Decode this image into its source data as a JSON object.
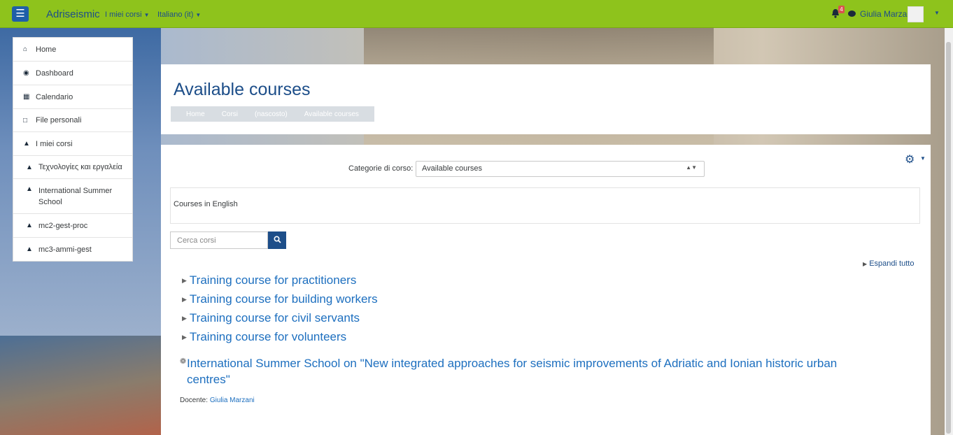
{
  "navbar": {
    "brand": "Adriseismic",
    "menus": [
      {
        "label": "I miei corsi",
        "icon": "caret-down-icon"
      },
      {
        "label": "Italiano (it)",
        "icon": "caret-down-icon"
      }
    ],
    "notification_count": "4",
    "user_name": "Giulia Marzani",
    "colors": {
      "bar": "#8ec31c",
      "toggle": "#1f5fa8"
    }
  },
  "sidebar": {
    "items": [
      {
        "label": "Home",
        "icon": "home-icon"
      },
      {
        "label": "Dashboard",
        "icon": "dashboard-icon"
      },
      {
        "label": "Calendario",
        "icon": "calendar-icon"
      },
      {
        "label": "File personali",
        "icon": "file-icon"
      },
      {
        "label": "I miei corsi",
        "icon": "graduation-cap-icon"
      },
      {
        "label": "Τεχνολογίες και εργαλεία",
        "icon": "graduation-cap-icon"
      },
      {
        "label": "International Summer School",
        "icon": "graduation-cap-icon"
      },
      {
        "label": "mc2-gest-proc",
        "icon": "graduation-cap-icon"
      },
      {
        "label": "mc3-ammi-gest",
        "icon": "graduation-cap-icon"
      }
    ]
  },
  "header": {
    "title": "Available courses",
    "breadcrumb": [
      "Home",
      "Corsi",
      "(nascosto)",
      "Available courses"
    ]
  },
  "main": {
    "category_label": "Categorie di corso:",
    "category_selected": "Available courses",
    "info_text": "Courses in English",
    "search_placeholder": "Cerca corsi",
    "expand_all": "Espandi tutto",
    "courses": [
      "Training course for practitioners",
      "Training course for building workers",
      "Training course for civil servants",
      "Training course for volunteers"
    ],
    "summer_school": "International Summer School on \"New integrated approaches for seismic improvements of Adriatic and Ionian historic urban centres\"",
    "teacher_label": "Docente:",
    "teacher_name": "Giulia Marzani"
  }
}
